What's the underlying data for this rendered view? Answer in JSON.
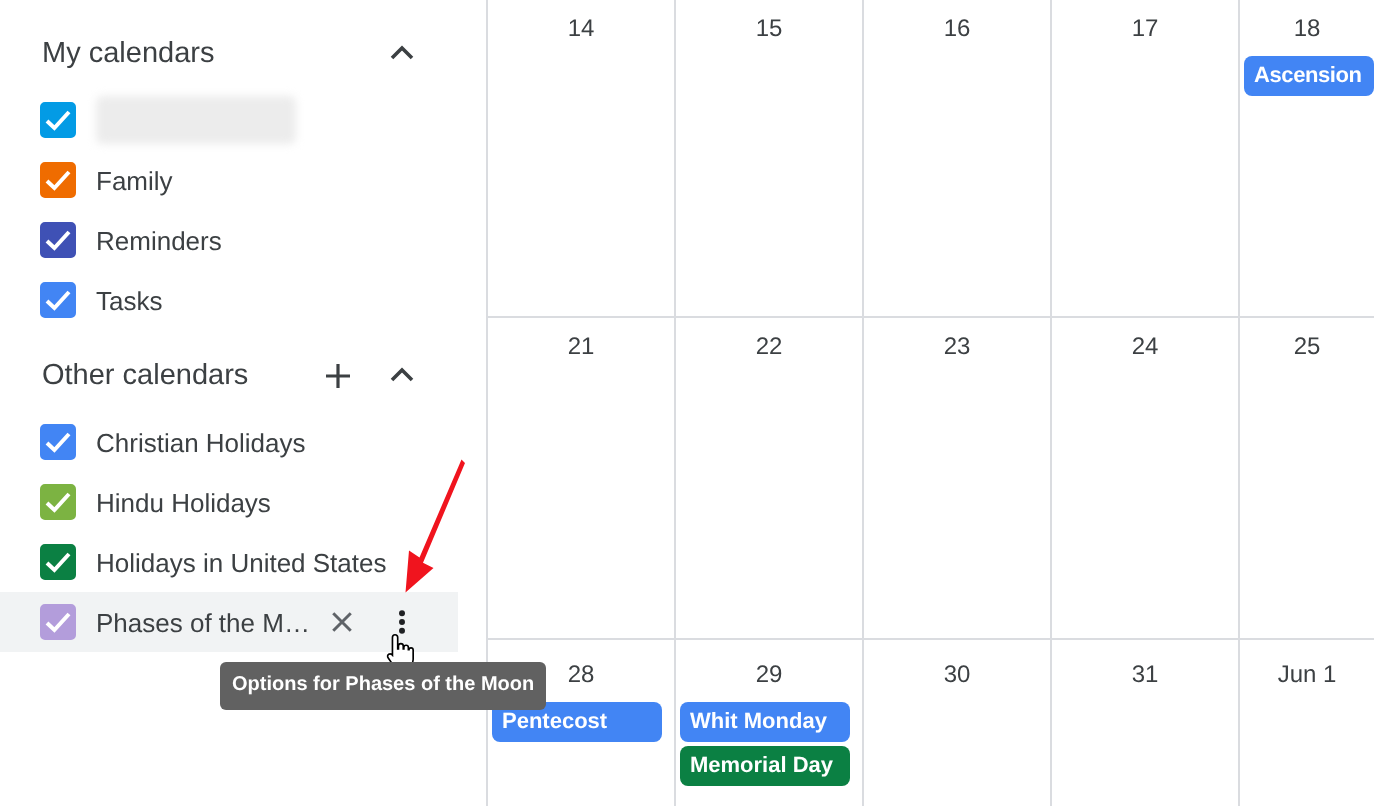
{
  "sidebar": {
    "sections": [
      {
        "title": "My calendars",
        "expanded": true,
        "can_add": false,
        "items": [
          {
            "kind": "redacted",
            "color": "#039be5",
            "checked": true
          },
          {
            "kind": "calendar",
            "label": "Family",
            "color": "#ef6c00",
            "checked": true
          },
          {
            "kind": "calendar",
            "label": "Reminders",
            "color": "#3f51b5",
            "checked": true
          },
          {
            "kind": "calendar",
            "label": "Tasks",
            "color": "#4285f4",
            "checked": true
          }
        ]
      },
      {
        "title": "Other calendars",
        "expanded": true,
        "can_add": true,
        "items": [
          {
            "kind": "calendar",
            "label": "Christian Holidays",
            "color": "#4285f4",
            "checked": true
          },
          {
            "kind": "calendar",
            "label": "Hindu Holidays",
            "color": "#7cb342",
            "checked": true
          },
          {
            "kind": "calendar",
            "label": "Holidays in United States",
            "color": "#0b8043",
            "checked": true
          },
          {
            "kind": "calendar",
            "label": "Phases of the M…",
            "color": "#b39ddb",
            "checked": true,
            "hovered": true
          }
        ]
      }
    ]
  },
  "tooltip": "Options for Phases of the Moon",
  "calendar": {
    "weeks": [
      [
        {
          "day": "14"
        },
        {
          "day": "15"
        },
        {
          "day": "16"
        },
        {
          "day": "17"
        },
        {
          "day": "18",
          "events": [
            {
              "title": "Ascension",
              "color": "#4285f4"
            }
          ]
        }
      ],
      [
        {
          "day": "21"
        },
        {
          "day": "22"
        },
        {
          "day": "23"
        },
        {
          "day": "24"
        },
        {
          "day": "25"
        }
      ],
      [
        {
          "day": "28",
          "events": [
            {
              "title": "Pentecost",
              "color": "#4285f4"
            }
          ]
        },
        {
          "day": "29",
          "events": [
            {
              "title": "Whit Monday",
              "color": "#4285f4"
            },
            {
              "title": "Memorial Day",
              "color": "#0b8043"
            }
          ]
        },
        {
          "day": "30"
        },
        {
          "day": "31"
        },
        {
          "day": "Jun 1"
        }
      ]
    ]
  }
}
